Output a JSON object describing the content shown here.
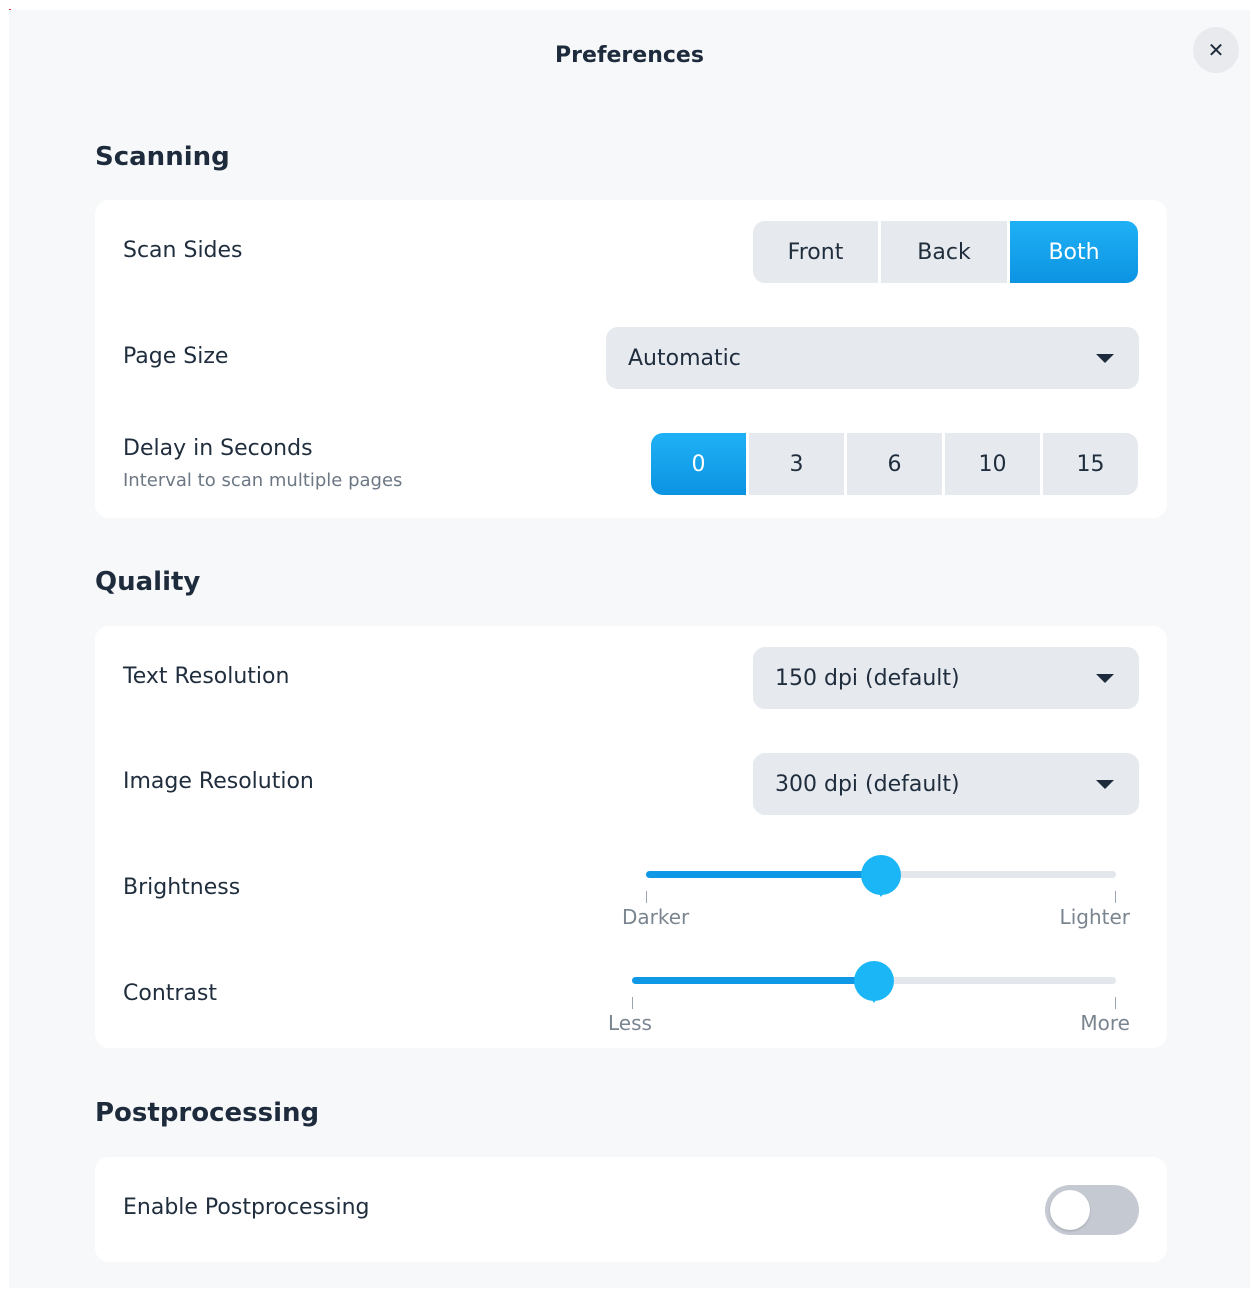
{
  "window": {
    "title": "Preferences",
    "close_icon": "close-icon"
  },
  "scanning": {
    "title": "Scanning",
    "scan_sides": {
      "label": "Scan Sides",
      "options": [
        "Front",
        "Back",
        "Both"
      ],
      "selected": "Both"
    },
    "page_size": {
      "label": "Page Size",
      "value": "Automatic"
    },
    "delay": {
      "label": "Delay in Seconds",
      "sublabel": "Interval to scan multiple pages",
      "options": [
        "0",
        "3",
        "6",
        "10",
        "15"
      ],
      "selected": "0"
    }
  },
  "quality": {
    "title": "Quality",
    "text_resolution": {
      "label": "Text Resolution",
      "value": "150 dpi (default)"
    },
    "image_resolution": {
      "label": "Image Resolution",
      "value": "300 dpi (default)"
    },
    "brightness": {
      "label": "Brightness",
      "min_label": "Darker",
      "max_label": "Lighter",
      "value": 0.5
    },
    "contrast": {
      "label": "Contrast",
      "min_label": "Less",
      "max_label": "More",
      "value": 0.5
    }
  },
  "postprocessing": {
    "title": "Postprocessing",
    "enable": {
      "label": "Enable Postprocessing",
      "on": false
    }
  },
  "colors": {
    "accent": "#0c93e2",
    "accent_light": "#1ab6f6",
    "background": "#f7f8f9",
    "card": "#ffffff",
    "control": "#e6e9ee"
  }
}
